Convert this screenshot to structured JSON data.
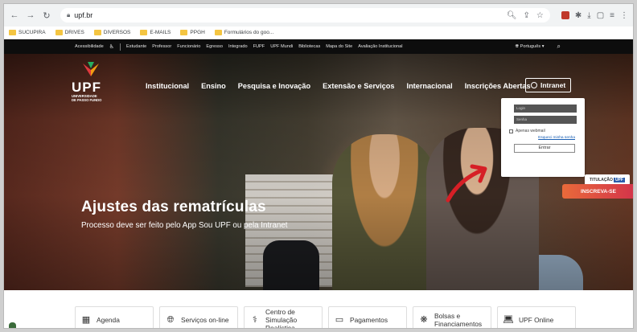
{
  "browser": {
    "url": "upf.br",
    "bookmarks": [
      "SUCUPIRA",
      "DRIVES",
      "DIVERSOS",
      "E-MAILS",
      "PPGH",
      "Formulários do goo..."
    ]
  },
  "topbar": {
    "items": [
      "Acessibilidade",
      "Estudante",
      "Professor",
      "Funcionário",
      "Egresso",
      "Integrado",
      "FUPF",
      "UPF Mundi",
      "Bibliotecas",
      "Mapa do Site",
      "Avaliação Institucional"
    ],
    "language": "Português"
  },
  "logo": {
    "name": "UPF",
    "subtitle_1": "UNIVERSIDADE",
    "subtitle_2": "DE PASSO FUNDO"
  },
  "nav": {
    "menu": [
      "Institucional",
      "Ensino",
      "Pesquisa e Inovação",
      "Extensão e Serviços",
      "Internacional",
      "Inscrições Abertas"
    ],
    "intranet": "Intranet"
  },
  "login": {
    "login_placeholder": "Login",
    "password_placeholder": "Senha",
    "webmail_label": "Apenas webmail",
    "forgot_label": "Esqueci minha senha",
    "enter_label": "Entrar"
  },
  "promo": {
    "badge_text": "TITULAÇÃO",
    "badge_brand": "UPF",
    "cta": "INSCREVA-SE"
  },
  "hero": {
    "title": "Ajustes das rematrículas",
    "subtitle": "Processo deve ser feito pelo App Sou UPF ou pela Intranet",
    "slide_active": 1,
    "slide_count": 2
  },
  "quick_links": [
    "Agenda",
    "Serviços on-line",
    "Centro de Simulação Realística",
    "Pagamentos",
    "Bolsas e Financiamentos",
    "UPF Online"
  ],
  "colors": {
    "inscreva_start": "#e96a3a",
    "inscreva_end": "#d3344a",
    "topbar": "#0d0d0d",
    "arrow": "#d61f26"
  }
}
